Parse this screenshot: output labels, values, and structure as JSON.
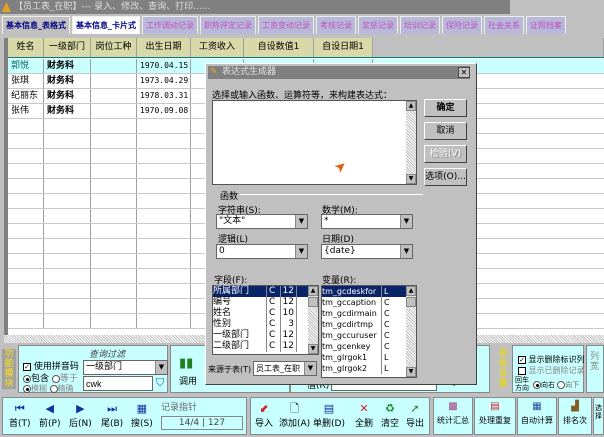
{
  "window": {
    "title": "【员工表_在职】--- 录入、修改、查询、打印......"
  },
  "tabs": [
    "基本信息_表格式",
    "基本信息_卡片式",
    "工作调动记录",
    "职称评定记录",
    "工资变动记录",
    "考核记录",
    "奖惩记录",
    "培训记录",
    "保险记录",
    "社会关系",
    "证照档案"
  ],
  "grid": {
    "columns": [
      "姓名",
      "一级部门",
      "岗位工种",
      "出生日期",
      "工资收入",
      "自设数值1",
      "自设日期1"
    ],
    "rows": [
      [
        "郭悦",
        "财务科",
        "",
        "1970.04.15",
        "",
        "",
        ""
      ],
      [
        "张琪",
        "财务科",
        "",
        "1973.04.29",
        "",
        "",
        ""
      ],
      [
        "纪丽东",
        "财务科",
        "",
        "1978.03.31",
        "",
        "",
        ""
      ],
      [
        "张伟",
        "财务科",
        "",
        "1970.09.08",
        "",
        "",
        ""
      ]
    ]
  },
  "panel": {
    "module_label": "功能模块",
    "filter_title": "查询过滤",
    "use_pinyin": "使用拼音码",
    "contains": "包含",
    "equals": "等于",
    "fuzzy": "模糊",
    "exact": "精确",
    "field_select": "一级部门",
    "query_value": "cwk",
    "call_label": "调用",
    "value_label": "值(R)",
    "table_settings_label": "表格设置",
    "show_delete_flag": "显示删除标识列",
    "show_deleted_records": "显示已删除记录",
    "enter_direction": "回车方向",
    "right": "向右",
    "down": "向下",
    "col_width": "列宽"
  },
  "navbar": {
    "first": "首(T)",
    "prev": "前(P)",
    "next": "后(N)",
    "last": "尾(B)",
    "search": "搜(S)",
    "record_pointer_label": "记录指针",
    "record_pointer": "14/4",
    "record_total": "127",
    "import": "导入",
    "add": "添加(A)",
    "delete_one": "单删(D)",
    "delete_all": "全删",
    "clear": "清空",
    "export": "导出",
    "stats": "统计汇总",
    "dedupe": "处理重复",
    "autocalc": "自动计算",
    "rank": "排名次",
    "select": "选择"
  },
  "dialog": {
    "title": "表达式生成器",
    "prompt": "选择或输入函数、运算符等，来构建表达式：",
    "expression": "",
    "ok": "确定",
    "cancel": "取消",
    "verify": "检验(V)",
    "options": "选项(O)...",
    "functions_label": "函数",
    "string_label": "字符串(S):",
    "string_value": "\"文本\"",
    "math_label": "数学(M):",
    "math_value": "*",
    "logic_label": "逻辑(L)",
    "logic_value": "0",
    "date_label": "日期(D)",
    "date_value": "{date}",
    "fields_label": "字段(F):",
    "fields": [
      [
        "所属部门",
        "C",
        "12"
      ],
      [
        "编号",
        "C",
        "12"
      ],
      [
        "姓名",
        "C",
        "10"
      ],
      [
        "性别",
        "C",
        "3"
      ],
      [
        "一级部门",
        "C",
        "12"
      ],
      [
        "二级部门",
        "C",
        "12"
      ]
    ],
    "variables_label": "变量(R):",
    "variables": [
      [
        "tm_gcdeskfor",
        "L"
      ],
      [
        "tm_gccaption",
        "C"
      ],
      [
        "tm_gcdirmain",
        "C"
      ],
      [
        "tm_gcdirtmp",
        "C"
      ],
      [
        "tm_gccuruser",
        "C"
      ],
      [
        "tm_gcenkey",
        "C"
      ],
      [
        "tm_glrgok1",
        "L"
      ],
      [
        "tm_glrgok2",
        "L"
      ]
    ],
    "from_table_label": "来源于表(T)",
    "from_table": "员工表_在职"
  }
}
